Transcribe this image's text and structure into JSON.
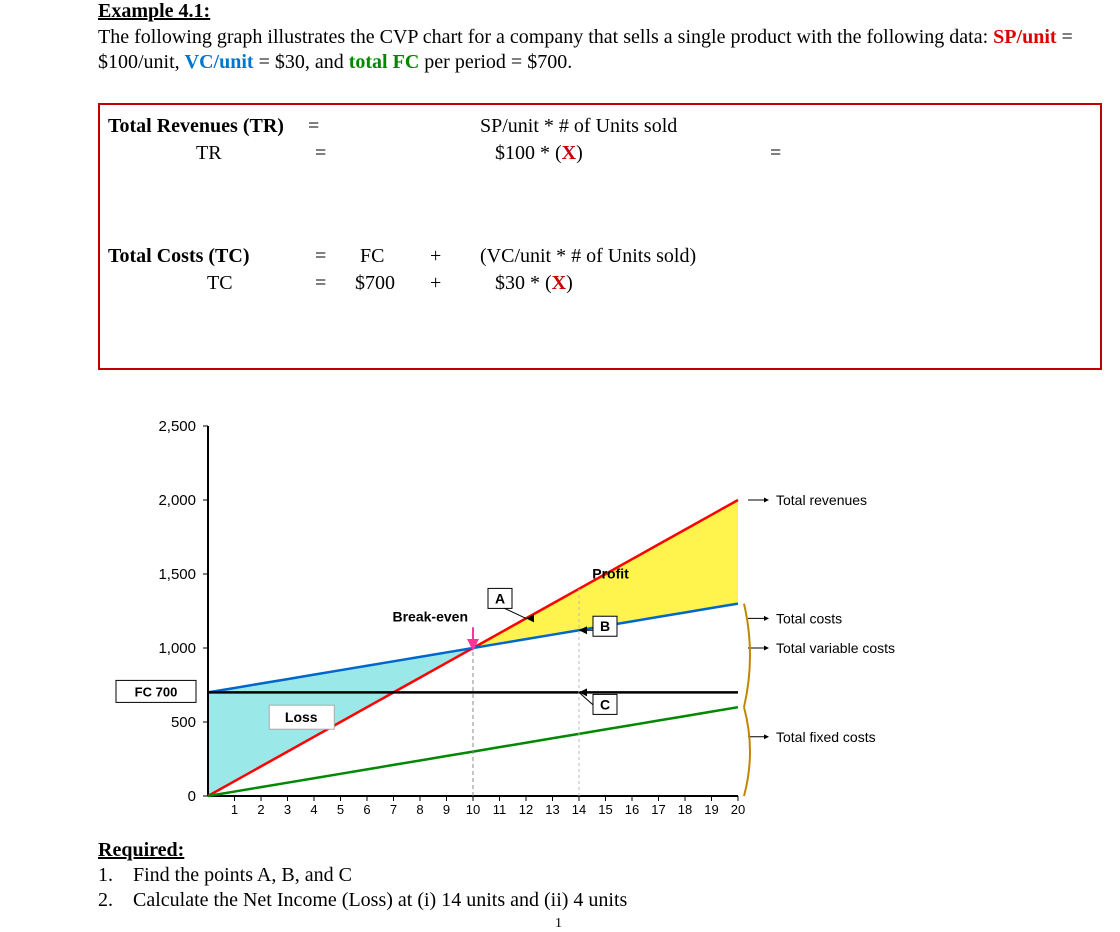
{
  "title": "Example 4.1:",
  "intro": {
    "pre": "The following graph illustrates the CVP chart for a company that sells a single product with the following data: ",
    "sp_label": "SP/unit",
    "sp_val": " = $100/unit, ",
    "vc_label": "VC/unit",
    "vc_val": " = $30, and ",
    "fc_label": "total FC",
    "fc_val": " per period = $700."
  },
  "formulas": {
    "tr1_l": "Total Revenues (TR)",
    "tr1_eq": "=",
    "tr1_r": "SP/unit  *  # of Units sold",
    "tr2_l": "TR",
    "tr2_eq": "=",
    "tr2_r1": "$100  *  (",
    "tr2_x": "X",
    "tr2_r2": ")",
    "tr2_tail": "=",
    "tc1_l": "Total Costs (TC)",
    "tc1_eq": "=",
    "tc1_fc": "FC",
    "tc1_plus": "+",
    "tc1_r": "(VC/unit  *  # of Units sold)",
    "tc2_l": "TC",
    "tc2_eq": "=",
    "tc2_fc": "$700",
    "tc2_plus": "+",
    "tc2_r1": "$30  *  (",
    "tc2_x": "X",
    "tc2_r2": ")"
  },
  "chart_data": {
    "type": "line",
    "x": [
      0,
      1,
      2,
      3,
      4,
      5,
      6,
      7,
      8,
      9,
      10,
      11,
      12,
      13,
      14,
      15,
      16,
      17,
      18,
      19,
      20
    ],
    "series": [
      {
        "name": "Total revenues",
        "values": [
          0,
          100,
          200,
          300,
          400,
          500,
          600,
          700,
          800,
          900,
          1000,
          1100,
          1200,
          1300,
          1400,
          1500,
          1600,
          1700,
          1800,
          1900,
          2000
        ],
        "color": "#ff0000"
      },
      {
        "name": "Total costs",
        "values": [
          700,
          730,
          760,
          790,
          820,
          850,
          880,
          910,
          940,
          970,
          1000,
          1030,
          1060,
          1090,
          1120,
          1150,
          1180,
          1210,
          1240,
          1270,
          1300
        ],
        "color": "#0066cc"
      },
      {
        "name": "Total variable costs",
        "values": [
          0,
          30,
          60,
          90,
          120,
          150,
          180,
          210,
          240,
          270,
          300,
          330,
          360,
          390,
          420,
          450,
          480,
          510,
          540,
          570,
          600
        ],
        "color": "#008800"
      },
      {
        "name": "Total fixed costs",
        "values": [
          700,
          700,
          700,
          700,
          700,
          700,
          700,
          700,
          700,
          700,
          700,
          700,
          700,
          700,
          700,
          700,
          700,
          700,
          700,
          700,
          700
        ],
        "color": "#000000"
      }
    ],
    "xlabel": "",
    "ylabel": "",
    "ylim": [
      0,
      2500
    ],
    "xlim": [
      0,
      20
    ],
    "yticks": [
      0,
      500,
      1000,
      1500,
      2000,
      2500
    ],
    "fc_line_label": "FC 700",
    "annotations": {
      "break_even_label": "Break-even",
      "break_even_x": 10,
      "loss_label": "Loss",
      "profit_label": "Profit",
      "markers": {
        "A": {
          "x": 12,
          "series": "Total revenues"
        },
        "B": {
          "x": 14,
          "series": "Total costs"
        },
        "C": {
          "x": 14,
          "series": "Total fixed costs"
        }
      }
    },
    "legend": [
      "Total revenues",
      "Total costs",
      "Total variable costs",
      "Total fixed costs"
    ]
  },
  "required": {
    "hd": "Required:",
    "q1": "Find the points A, B, and C",
    "q2": "Calculate the Net Income (Loss) at (i) 14 units and (ii) 4 units"
  },
  "page": "1"
}
